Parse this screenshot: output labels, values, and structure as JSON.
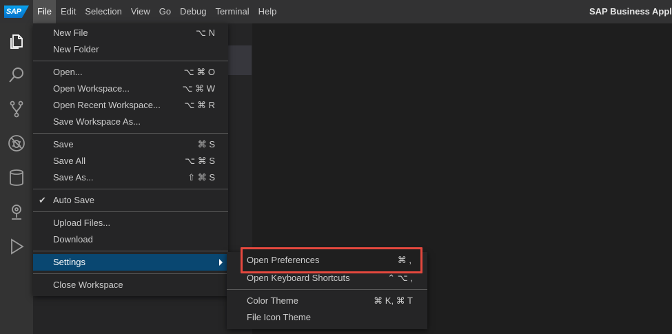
{
  "menubar": {
    "logo": "SAP",
    "items": [
      "File",
      "Edit",
      "Selection",
      "View",
      "Go",
      "Debug",
      "Terminal",
      "Help"
    ],
    "active": "File",
    "app_title": "SAP Business Appl"
  },
  "activitybar": {
    "icons": [
      "explorer-icon",
      "search-icon",
      "source-control-icon",
      "debug-icon",
      "database-icon",
      "location-pin-icon",
      "run-icon"
    ]
  },
  "file_menu": {
    "items": [
      {
        "label": "New File",
        "shortcut": "⌥ N"
      },
      {
        "label": "New Folder",
        "shortcut": ""
      },
      {
        "label": "Open...",
        "shortcut": "⌥ ⌘ O"
      },
      {
        "label": "Open Workspace...",
        "shortcut": "⌥ ⌘ W"
      },
      {
        "label": "Open Recent Workspace...",
        "shortcut": "⌥ ⌘ R"
      },
      {
        "label": "Save Workspace As...",
        "shortcut": ""
      },
      {
        "label": "Save",
        "shortcut": "⌘ S"
      },
      {
        "label": "Save All",
        "shortcut": "⌥ ⌘ S"
      },
      {
        "label": "Save As...",
        "shortcut": "⇧ ⌘ S"
      },
      {
        "label": "Auto Save",
        "shortcut": "",
        "checked": true
      },
      {
        "label": "Upload Files...",
        "shortcut": ""
      },
      {
        "label": "Download",
        "shortcut": ""
      },
      {
        "label": "Settings",
        "shortcut": "",
        "selected": true,
        "submenu": true
      },
      {
        "label": "Close Workspace",
        "shortcut": ""
      }
    ]
  },
  "settings_menu": {
    "items": [
      {
        "label": "Open Preferences",
        "shortcut": "⌘ ,"
      },
      {
        "label": "Open Keyboard Shortcuts",
        "shortcut": "⌃ ⌥ ,"
      },
      {
        "label": "Color Theme",
        "shortcut": "⌘ K, ⌘ T"
      },
      {
        "label": "File Icon Theme",
        "shortcut": ""
      }
    ]
  },
  "colors": {
    "menu_bg": "#252526",
    "selection": "#094771",
    "annotation": "#e5483e"
  }
}
